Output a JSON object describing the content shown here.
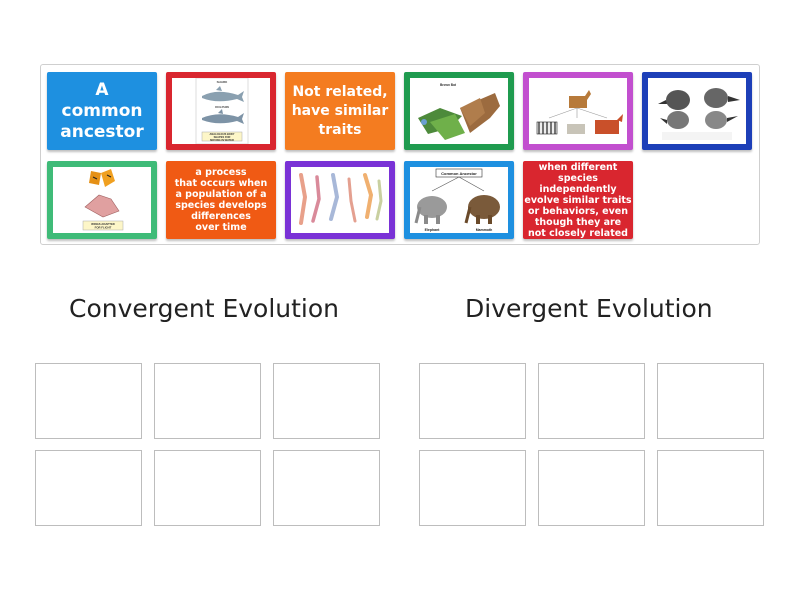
{
  "cards": [
    {
      "id": "card-common-ancestor",
      "type": "text",
      "text": "A\ncommon\nancestor",
      "color": "#1e90e0",
      "size": "big"
    },
    {
      "id": "card-shark-dolphin",
      "type": "image",
      "icon": "shark-dolphin-image",
      "color": "#d9262f"
    },
    {
      "id": "card-not-related",
      "type": "text",
      "text": "Not related,\nhave similar\ntraits",
      "color": "#f47c20",
      "size": "mid"
    },
    {
      "id": "card-bat-pterosaur",
      "type": "image",
      "icon": "bat-pterosaur-image",
      "color": "#1f9b4f"
    },
    {
      "id": "card-horse-zebra",
      "type": "image",
      "icon": "horse-zebra-image",
      "color": "#c24fcf"
    },
    {
      "id": "card-finches",
      "type": "image",
      "icon": "finch-beaks-image",
      "color": "#1d3fb8"
    },
    {
      "id": "card-butterfly-bat",
      "type": "image",
      "icon": "butterfly-bat-wing-image",
      "color": "#3fbb78"
    },
    {
      "id": "card-process-definition",
      "type": "text",
      "text": "a process\nthat occurs when\na population of a\nspecies develops\ndifferences\nover time",
      "color": "#f05a14",
      "size": "small"
    },
    {
      "id": "card-limbs",
      "type": "image",
      "icon": "homologous-limbs-image",
      "color": "#7a32d6"
    },
    {
      "id": "card-elephant-mammoth",
      "type": "image",
      "icon": "elephant-mammoth-image",
      "color": "#1e90e0"
    },
    {
      "id": "card-convergent-definition",
      "type": "text",
      "text": "when different\nspecies independently\nevolve similar traits\nor behaviors, even\nthough they are\nnot closely related",
      "color": "#d9262f",
      "size": "small"
    }
  ],
  "images": {
    "shark_caption": "ANALOGOUS BODY\nSHAPES FOR\nMOVING IN WATER",
    "shark_top_label": "SHARK",
    "shark_mid_label": "DOLPHIN",
    "butterfly_caption": "WINGS ADAPTED\nFOR FLIGHT",
    "ancestor_label": "Common Ancestor",
    "elephant_label": "Elephant",
    "mammoth_label": "Mammoth",
    "bat_label": "Brown Bat"
  },
  "columns": {
    "left_title": "Convergent Evolution",
    "right_title": "Divergent Evolution"
  },
  "colors": {
    "tray_border": "#cfcfcf",
    "slot_border": "#bdbdbd",
    "title_text": "#222222"
  }
}
